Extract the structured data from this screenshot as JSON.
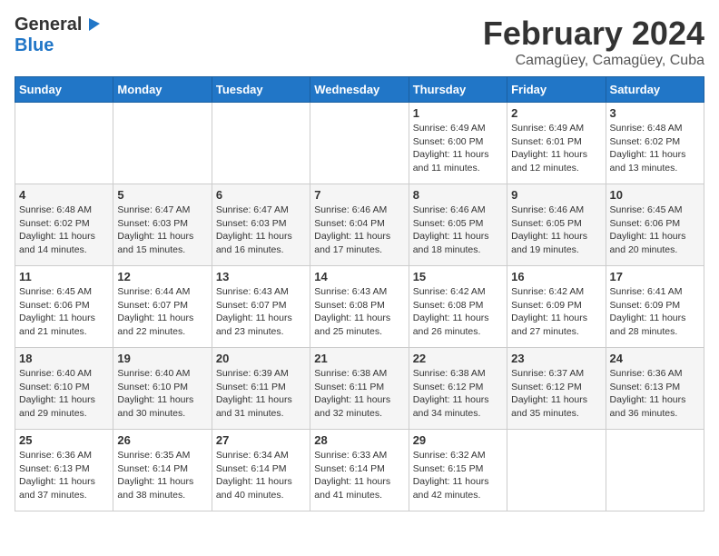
{
  "logo": {
    "general": "General",
    "blue": "Blue"
  },
  "title": "February 2024",
  "location": "Camagüey, Camagüey, Cuba",
  "days_of_week": [
    "Sunday",
    "Monday",
    "Tuesday",
    "Wednesday",
    "Thursday",
    "Friday",
    "Saturday"
  ],
  "weeks": [
    [
      {
        "day": "",
        "info": ""
      },
      {
        "day": "",
        "info": ""
      },
      {
        "day": "",
        "info": ""
      },
      {
        "day": "",
        "info": ""
      },
      {
        "day": "1",
        "info": "Sunrise: 6:49 AM\nSunset: 6:00 PM\nDaylight: 11 hours and 11 minutes."
      },
      {
        "day": "2",
        "info": "Sunrise: 6:49 AM\nSunset: 6:01 PM\nDaylight: 11 hours and 12 minutes."
      },
      {
        "day": "3",
        "info": "Sunrise: 6:48 AM\nSunset: 6:02 PM\nDaylight: 11 hours and 13 minutes."
      }
    ],
    [
      {
        "day": "4",
        "info": "Sunrise: 6:48 AM\nSunset: 6:02 PM\nDaylight: 11 hours and 14 minutes."
      },
      {
        "day": "5",
        "info": "Sunrise: 6:47 AM\nSunset: 6:03 PM\nDaylight: 11 hours and 15 minutes."
      },
      {
        "day": "6",
        "info": "Sunrise: 6:47 AM\nSunset: 6:03 PM\nDaylight: 11 hours and 16 minutes."
      },
      {
        "day": "7",
        "info": "Sunrise: 6:46 AM\nSunset: 6:04 PM\nDaylight: 11 hours and 17 minutes."
      },
      {
        "day": "8",
        "info": "Sunrise: 6:46 AM\nSunset: 6:05 PM\nDaylight: 11 hours and 18 minutes."
      },
      {
        "day": "9",
        "info": "Sunrise: 6:46 AM\nSunset: 6:05 PM\nDaylight: 11 hours and 19 minutes."
      },
      {
        "day": "10",
        "info": "Sunrise: 6:45 AM\nSunset: 6:06 PM\nDaylight: 11 hours and 20 minutes."
      }
    ],
    [
      {
        "day": "11",
        "info": "Sunrise: 6:45 AM\nSunset: 6:06 PM\nDaylight: 11 hours and 21 minutes."
      },
      {
        "day": "12",
        "info": "Sunrise: 6:44 AM\nSunset: 6:07 PM\nDaylight: 11 hours and 22 minutes."
      },
      {
        "day": "13",
        "info": "Sunrise: 6:43 AM\nSunset: 6:07 PM\nDaylight: 11 hours and 23 minutes."
      },
      {
        "day": "14",
        "info": "Sunrise: 6:43 AM\nSunset: 6:08 PM\nDaylight: 11 hours and 25 minutes."
      },
      {
        "day": "15",
        "info": "Sunrise: 6:42 AM\nSunset: 6:08 PM\nDaylight: 11 hours and 26 minutes."
      },
      {
        "day": "16",
        "info": "Sunrise: 6:42 AM\nSunset: 6:09 PM\nDaylight: 11 hours and 27 minutes."
      },
      {
        "day": "17",
        "info": "Sunrise: 6:41 AM\nSunset: 6:09 PM\nDaylight: 11 hours and 28 minutes."
      }
    ],
    [
      {
        "day": "18",
        "info": "Sunrise: 6:40 AM\nSunset: 6:10 PM\nDaylight: 11 hours and 29 minutes."
      },
      {
        "day": "19",
        "info": "Sunrise: 6:40 AM\nSunset: 6:10 PM\nDaylight: 11 hours and 30 minutes."
      },
      {
        "day": "20",
        "info": "Sunrise: 6:39 AM\nSunset: 6:11 PM\nDaylight: 11 hours and 31 minutes."
      },
      {
        "day": "21",
        "info": "Sunrise: 6:38 AM\nSunset: 6:11 PM\nDaylight: 11 hours and 32 minutes."
      },
      {
        "day": "22",
        "info": "Sunrise: 6:38 AM\nSunset: 6:12 PM\nDaylight: 11 hours and 34 minutes."
      },
      {
        "day": "23",
        "info": "Sunrise: 6:37 AM\nSunset: 6:12 PM\nDaylight: 11 hours and 35 minutes."
      },
      {
        "day": "24",
        "info": "Sunrise: 6:36 AM\nSunset: 6:13 PM\nDaylight: 11 hours and 36 minutes."
      }
    ],
    [
      {
        "day": "25",
        "info": "Sunrise: 6:36 AM\nSunset: 6:13 PM\nDaylight: 11 hours and 37 minutes."
      },
      {
        "day": "26",
        "info": "Sunrise: 6:35 AM\nSunset: 6:14 PM\nDaylight: 11 hours and 38 minutes."
      },
      {
        "day": "27",
        "info": "Sunrise: 6:34 AM\nSunset: 6:14 PM\nDaylight: 11 hours and 40 minutes."
      },
      {
        "day": "28",
        "info": "Sunrise: 6:33 AM\nSunset: 6:14 PM\nDaylight: 11 hours and 41 minutes."
      },
      {
        "day": "29",
        "info": "Sunrise: 6:32 AM\nSunset: 6:15 PM\nDaylight: 11 hours and 42 minutes."
      },
      {
        "day": "",
        "info": ""
      },
      {
        "day": "",
        "info": ""
      }
    ]
  ]
}
